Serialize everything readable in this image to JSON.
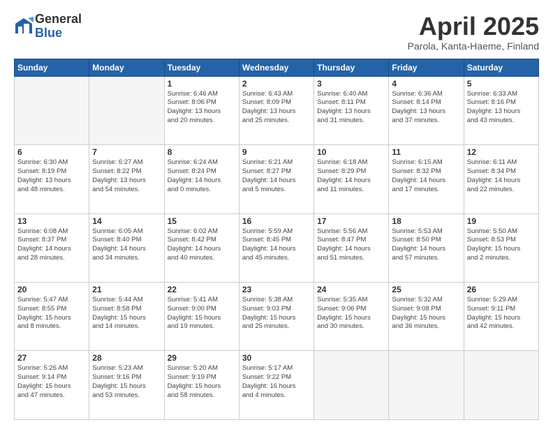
{
  "header": {
    "logo_general": "General",
    "logo_blue": "Blue",
    "title": "April 2025",
    "subtitle": "Parola, Kanta-Haeme, Finland"
  },
  "days_of_week": [
    "Sunday",
    "Monday",
    "Tuesday",
    "Wednesday",
    "Thursday",
    "Friday",
    "Saturday"
  ],
  "weeks": [
    [
      {
        "day": "",
        "info": ""
      },
      {
        "day": "",
        "info": ""
      },
      {
        "day": "1",
        "info": "Sunrise: 6:46 AM\nSunset: 8:06 PM\nDaylight: 13 hours\nand 20 minutes."
      },
      {
        "day": "2",
        "info": "Sunrise: 6:43 AM\nSunset: 8:09 PM\nDaylight: 13 hours\nand 25 minutes."
      },
      {
        "day": "3",
        "info": "Sunrise: 6:40 AM\nSunset: 8:11 PM\nDaylight: 13 hours\nand 31 minutes."
      },
      {
        "day": "4",
        "info": "Sunrise: 6:36 AM\nSunset: 8:14 PM\nDaylight: 13 hours\nand 37 minutes."
      },
      {
        "day": "5",
        "info": "Sunrise: 6:33 AM\nSunset: 8:16 PM\nDaylight: 13 hours\nand 43 minutes."
      }
    ],
    [
      {
        "day": "6",
        "info": "Sunrise: 6:30 AM\nSunset: 8:19 PM\nDaylight: 13 hours\nand 48 minutes."
      },
      {
        "day": "7",
        "info": "Sunrise: 6:27 AM\nSunset: 8:22 PM\nDaylight: 13 hours\nand 54 minutes."
      },
      {
        "day": "8",
        "info": "Sunrise: 6:24 AM\nSunset: 8:24 PM\nDaylight: 14 hours\nand 0 minutes."
      },
      {
        "day": "9",
        "info": "Sunrise: 6:21 AM\nSunset: 8:27 PM\nDaylight: 14 hours\nand 5 minutes."
      },
      {
        "day": "10",
        "info": "Sunrise: 6:18 AM\nSunset: 8:29 PM\nDaylight: 14 hours\nand 11 minutes."
      },
      {
        "day": "11",
        "info": "Sunrise: 6:15 AM\nSunset: 8:32 PM\nDaylight: 14 hours\nand 17 minutes."
      },
      {
        "day": "12",
        "info": "Sunrise: 6:11 AM\nSunset: 8:34 PM\nDaylight: 14 hours\nand 22 minutes."
      }
    ],
    [
      {
        "day": "13",
        "info": "Sunrise: 6:08 AM\nSunset: 8:37 PM\nDaylight: 14 hours\nand 28 minutes."
      },
      {
        "day": "14",
        "info": "Sunrise: 6:05 AM\nSunset: 8:40 PM\nDaylight: 14 hours\nand 34 minutes."
      },
      {
        "day": "15",
        "info": "Sunrise: 6:02 AM\nSunset: 8:42 PM\nDaylight: 14 hours\nand 40 minutes."
      },
      {
        "day": "16",
        "info": "Sunrise: 5:59 AM\nSunset: 8:45 PM\nDaylight: 14 hours\nand 45 minutes."
      },
      {
        "day": "17",
        "info": "Sunrise: 5:56 AM\nSunset: 8:47 PM\nDaylight: 14 hours\nand 51 minutes."
      },
      {
        "day": "18",
        "info": "Sunrise: 5:53 AM\nSunset: 8:50 PM\nDaylight: 14 hours\nand 57 minutes."
      },
      {
        "day": "19",
        "info": "Sunrise: 5:50 AM\nSunset: 8:53 PM\nDaylight: 15 hours\nand 2 minutes."
      }
    ],
    [
      {
        "day": "20",
        "info": "Sunrise: 5:47 AM\nSunset: 8:55 PM\nDaylight: 15 hours\nand 8 minutes."
      },
      {
        "day": "21",
        "info": "Sunrise: 5:44 AM\nSunset: 8:58 PM\nDaylight: 15 hours\nand 14 minutes."
      },
      {
        "day": "22",
        "info": "Sunrise: 5:41 AM\nSunset: 9:00 PM\nDaylight: 15 hours\nand 19 minutes."
      },
      {
        "day": "23",
        "info": "Sunrise: 5:38 AM\nSunset: 9:03 PM\nDaylight: 15 hours\nand 25 minutes."
      },
      {
        "day": "24",
        "info": "Sunrise: 5:35 AM\nSunset: 9:06 PM\nDaylight: 15 hours\nand 30 minutes."
      },
      {
        "day": "25",
        "info": "Sunrise: 5:32 AM\nSunset: 9:08 PM\nDaylight: 15 hours\nand 36 minutes."
      },
      {
        "day": "26",
        "info": "Sunrise: 5:29 AM\nSunset: 9:11 PM\nDaylight: 15 hours\nand 42 minutes."
      }
    ],
    [
      {
        "day": "27",
        "info": "Sunrise: 5:26 AM\nSunset: 9:14 PM\nDaylight: 15 hours\nand 47 minutes."
      },
      {
        "day": "28",
        "info": "Sunrise: 5:23 AM\nSunset: 9:16 PM\nDaylight: 15 hours\nand 53 minutes."
      },
      {
        "day": "29",
        "info": "Sunrise: 5:20 AM\nSunset: 9:19 PM\nDaylight: 15 hours\nand 58 minutes."
      },
      {
        "day": "30",
        "info": "Sunrise: 5:17 AM\nSunset: 9:22 PM\nDaylight: 16 hours\nand 4 minutes."
      },
      {
        "day": "",
        "info": ""
      },
      {
        "day": "",
        "info": ""
      },
      {
        "day": "",
        "info": ""
      }
    ]
  ]
}
